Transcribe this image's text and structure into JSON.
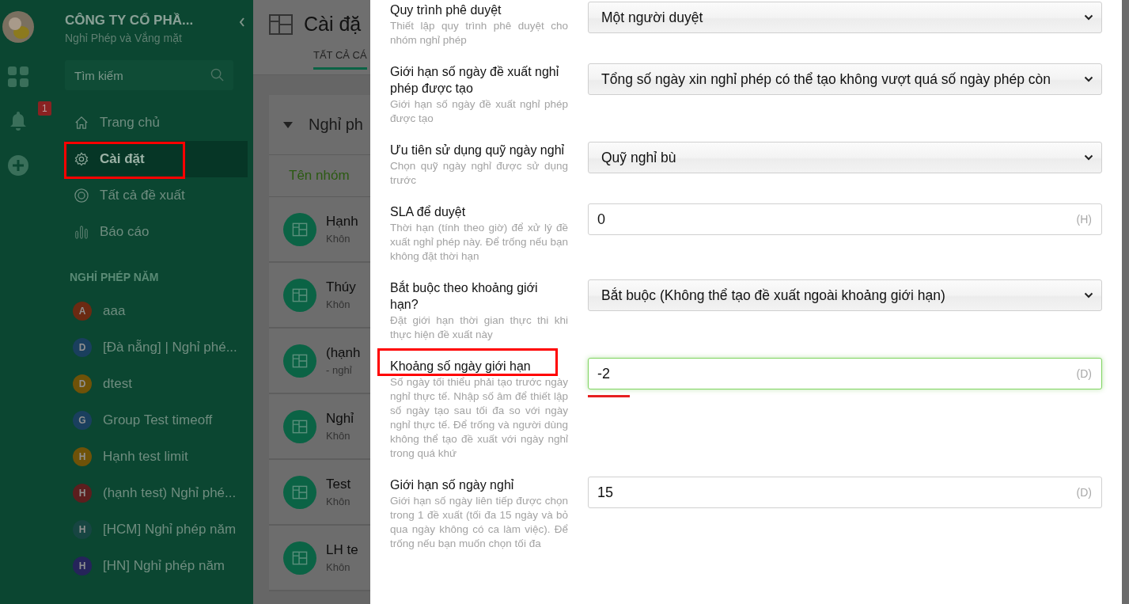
{
  "rail": {
    "notification_count": "1"
  },
  "sidebar": {
    "company": "CÔNG TY CỔ PHẦ...",
    "app_name": "Nghỉ Phép và Vắng mặt",
    "search": {
      "placeholder": "Tìm kiếm"
    },
    "nav_items": [
      {
        "label": "Trang chủ",
        "selected": false,
        "highlighted": false
      },
      {
        "label": "Cài đặt",
        "selected": true,
        "highlighted": true
      },
      {
        "label": "Tất cả đề xuất",
        "selected": false,
        "highlighted": false
      },
      {
        "label": "Báo cáo",
        "selected": false,
        "highlighted": false
      }
    ],
    "section_title": "NGHỈ PHÉP NĂM",
    "groups": [
      {
        "initial": "A",
        "name": "aaa",
        "color": "#6b2a12"
      },
      {
        "initial": "D",
        "name": "[Đà nẵng] | Nghỉ phé...",
        "color": "#1a3f5e"
      },
      {
        "initial": "D",
        "name": "dtest",
        "color": "#6f5208"
      },
      {
        "initial": "G",
        "name": "Group Test timeoff",
        "color": "#1a3f5e"
      },
      {
        "initial": "H",
        "name": "Hạnh test limit",
        "color": "#6f5208"
      },
      {
        "initial": "H",
        "name": "(hạnh test) Nghỉ phé...",
        "color": "#5c1e1e"
      },
      {
        "initial": "H",
        "name": "[HCM] Nghỉ phép năm",
        "color": "#174542"
      },
      {
        "initial": "H",
        "name": "[HN] Nghỉ phép năm",
        "color": "#25245a"
      }
    ]
  },
  "main": {
    "title": "Cài đặ",
    "tab": "TẤT CẢ CÁ",
    "card_title": "Nghỉ ph",
    "column": "Tên nhóm",
    "rows": [
      {
        "title": "Hạnh",
        "subtitle": "Khôn"
      },
      {
        "title": "Thúy",
        "subtitle": "Khôn"
      },
      {
        "title": "(hạnh",
        "subtitle": "- nghỉ"
      },
      {
        "title": "Nghỉ",
        "subtitle": "Khôn"
      },
      {
        "title": "Test",
        "subtitle": "Khôn"
      },
      {
        "title": "LH te",
        "subtitle": "Khôn"
      }
    ]
  },
  "settings": [
    {
      "kind": "select",
      "title": "Quy trình phê duyệt",
      "description": "Thiết lập quy trình phê duyệt cho nhóm nghỉ phép",
      "value": "Một người duyệt",
      "focused": false,
      "highlighted": false
    },
    {
      "kind": "select",
      "title": "Giới hạn số ngày đề xuất nghỉ phép được tạo",
      "description": "Giới hạn số ngày đề xuất nghỉ phép được tạo",
      "value": "Tổng số ngày xin nghỉ phép có thể tạo không vượt quá số ngày phép còn",
      "focused": false,
      "highlighted": false
    },
    {
      "kind": "select",
      "title": "Ưu tiên sử dụng quỹ ngày nghỉ",
      "description": "Chọn quỹ ngày nghỉ được sử dụng trước",
      "value": "Quỹ nghỉ bù",
      "focused": false,
      "highlighted": false
    },
    {
      "kind": "input",
      "title": "SLA để duyệt",
      "description": "Thời hạn (tính theo giờ) để xử lý đề xuất nghỉ phép này. Để trống nếu bạn không đặt thời hạn",
      "value": "0",
      "unit": "(H)",
      "focused": false,
      "highlighted": false
    },
    {
      "kind": "select",
      "title": "Bắt buộc theo khoảng giới hạn?",
      "description": "Đặt giới hạn thời gian thực thi khi thực hiện đề xuất này",
      "value": "Bắt buộc (Không thể tạo đề xuất ngoài khoảng giới hạn)",
      "focused": false,
      "highlighted": false
    },
    {
      "kind": "input",
      "title": "Khoảng số ngày giới hạn",
      "description": "Số ngày tối thiểu phải tạo trước ngày nghỉ thực tế. Nhập số âm để thiết lập số ngày tạo sau tối đa so với ngày nghỉ thực tế. Để trống và người dùng không thể tạo đề xuất với ngày nghỉ trong quá khứ",
      "value": "-2",
      "unit": "(D)",
      "focused": true,
      "highlighted": true
    },
    {
      "kind": "input",
      "title": "Giới hạn số ngày nghỉ",
      "description": "Giới hạn số ngày liên tiếp được chọn trong 1 đề xuất (tối đa 15 ngày và bỏ qua ngày không có ca làm việc). Để trống nếu bạn muốn chọn tối đa",
      "value": "15",
      "unit": "(D)",
      "focused": false,
      "highlighted": false
    }
  ]
}
